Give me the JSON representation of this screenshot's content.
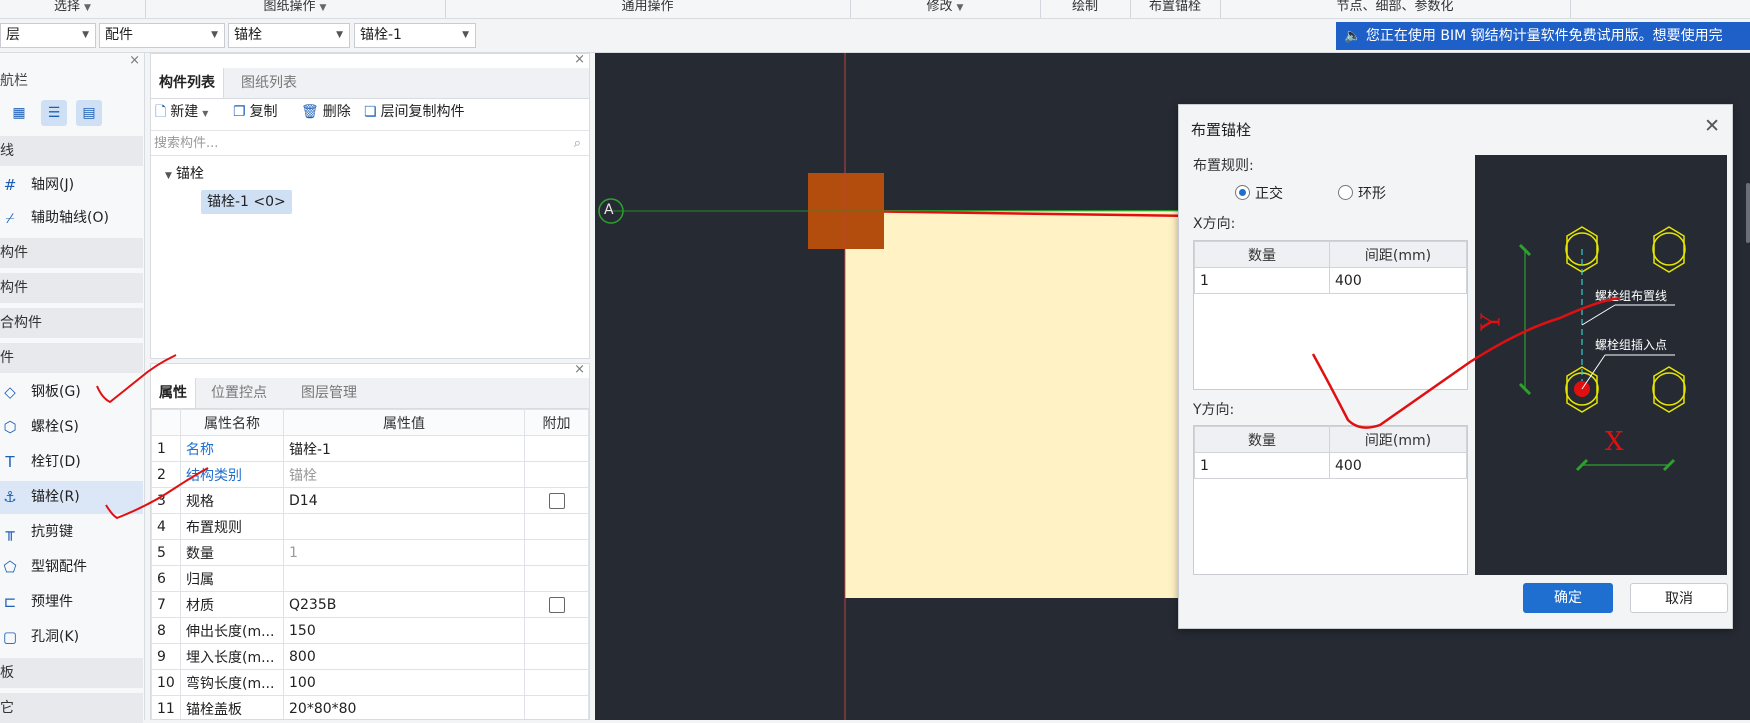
{
  "ribbon": {
    "groups": [
      {
        "label": "选择",
        "caret": "▼"
      },
      {
        "label": "图纸操作",
        "caret": "▼"
      },
      {
        "label": "通用操作",
        "caret": ""
      },
      {
        "label": "修改",
        "caret": "▼"
      },
      {
        "label": "绘制",
        "caret": ""
      },
      {
        "label": "布置锚栓",
        "caret": ""
      },
      {
        "label": "节点、细部、参数化",
        "caret": ""
      }
    ]
  },
  "selectors": [
    {
      "value": "层"
    },
    {
      "value": "配件"
    },
    {
      "value": "锚栓"
    },
    {
      "value": "锚栓-1"
    }
  ],
  "notice": {
    "icon": "speaker-icon",
    "text": "您正在使用 BIM 钢结构计量软件免费试用版。想要使用完"
  },
  "nav": {
    "close": "×",
    "title": "航栏",
    "sections": [
      "线",
      "构件",
      "构件",
      "合构件",
      "件",
      "板",
      "它"
    ],
    "items": [
      {
        "label": "轴网(J)",
        "icon": "grid-icon"
      },
      {
        "label": "辅助轴线(O)",
        "icon": "aux-axis-icon"
      },
      {
        "label": "钢板(G)",
        "icon": "steel-plate-icon"
      },
      {
        "label": "螺栓(S)",
        "icon": "bolt-icon"
      },
      {
        "label": "栓钉(D)",
        "icon": "stud-icon"
      },
      {
        "label": "锚栓(R)",
        "icon": "anchor-bolt-icon"
      },
      {
        "label": "抗剪键",
        "icon": "shear-key-icon"
      },
      {
        "label": "型钢配件",
        "icon": "section-steel-icon"
      },
      {
        "label": "预埋件",
        "icon": "embedded-part-icon"
      },
      {
        "label": "孔洞(K)",
        "icon": "hole-icon"
      }
    ]
  },
  "component_panel": {
    "tabs": [
      "构件列表",
      "图纸列表"
    ],
    "toolbar": [
      "新建",
      "复制",
      "删除",
      "层间复制构件"
    ],
    "search_placeholder": "搜索构件...",
    "tree_group": "锚栓",
    "tree_item": "锚栓-1 <0>"
  },
  "property_panel": {
    "tabs": [
      "属性",
      "位置控点",
      "图层管理"
    ],
    "headers": [
      "属性名称",
      "属性值",
      "附加"
    ],
    "rows": [
      {
        "no": "1",
        "name": "名称",
        "value": "锚栓-1",
        "name_blue": true,
        "value_gray": false,
        "check": false
      },
      {
        "no": "2",
        "name": "结构类别",
        "value": "锚栓",
        "name_blue": true,
        "value_gray": true,
        "check": false
      },
      {
        "no": "3",
        "name": "规格",
        "value": "D14",
        "name_blue": false,
        "value_gray": false,
        "check": true
      },
      {
        "no": "4",
        "name": "布置规则",
        "value": "",
        "name_blue": false,
        "value_gray": false,
        "check": false
      },
      {
        "no": "5",
        "name": "数量",
        "value": "1",
        "name_blue": false,
        "value_gray": true,
        "check": false
      },
      {
        "no": "6",
        "name": "归属",
        "value": "",
        "name_blue": false,
        "value_gray": false,
        "check": false
      },
      {
        "no": "7",
        "name": "材质",
        "value": "Q235B",
        "name_blue": false,
        "value_gray": false,
        "check": true
      },
      {
        "no": "8",
        "name": "伸出长度(m...",
        "value": "150",
        "name_blue": false,
        "value_gray": false,
        "check": false
      },
      {
        "no": "9",
        "name": "埋入长度(m...",
        "value": "800",
        "name_blue": false,
        "value_gray": false,
        "check": false
      },
      {
        "no": "10",
        "name": "弯钩长度(m...",
        "value": "100",
        "name_blue": false,
        "value_gray": false,
        "check": false
      },
      {
        "no": "11",
        "name": "锚栓盖板",
        "value": "20*80*80",
        "name_blue": false,
        "value_gray": false,
        "check": false
      }
    ]
  },
  "canvas": {
    "axis_label": "A"
  },
  "dialog": {
    "title": "布置锚栓",
    "rule_label": "布置规则:",
    "radio_orth": "正交",
    "radio_ring": "环形",
    "selected": "正交",
    "x_label": "X方向:",
    "y_label": "Y方向:",
    "headers": [
      "数量",
      "间距(mm)"
    ],
    "x_rows": [
      {
        "count": "1",
        "spacing": "400"
      }
    ],
    "y_rows": [
      {
        "count": "1",
        "spacing": "400"
      }
    ],
    "preview": {
      "label_line": "螺栓组布置线",
      "label_point": "螺栓组插入点",
      "axis_x": "X",
      "axis_y": "Y"
    },
    "ok": "确定",
    "cancel": "取消"
  },
  "colors": {
    "accent": "#1f6fd0",
    "canvas_bg": "#262b33",
    "plate": "#fff2c4",
    "anchor": "#b34d0d",
    "annotation": "#e01010"
  }
}
